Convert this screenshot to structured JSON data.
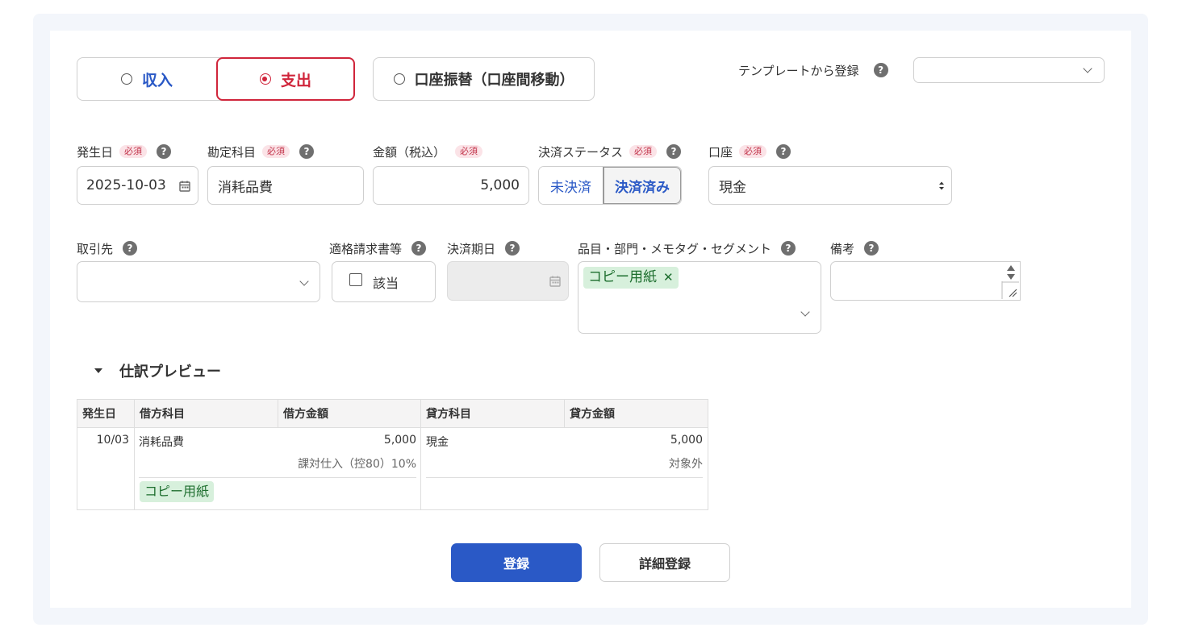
{
  "type_selector": {
    "income": "収入",
    "expense": "支出",
    "transfer": "口座振替（口座間移動）"
  },
  "template": {
    "label": "テンプレートから登録",
    "value": ""
  },
  "help_mark": "?",
  "required_badge": "必須",
  "fields": {
    "date": {
      "label": "発生日",
      "value": "2025-10-03"
    },
    "account_item": {
      "label": "勘定科目",
      "value": "消耗品費"
    },
    "amount": {
      "label": "金額（税込）",
      "value": "5,000"
    },
    "settlement": {
      "label": "決済ステータス",
      "unsettled": "未決済",
      "settled": "決済済み"
    },
    "wallet": {
      "label": "口座",
      "value": "現金"
    },
    "partner": {
      "label": "取引先",
      "value": ""
    },
    "invoice": {
      "label": "適格請求書等",
      "checkbox_label": "該当"
    },
    "due_date": {
      "label": "決済期日"
    },
    "tags": {
      "label": "品目・部門・メモタグ・セグメント",
      "tag": "コピー用紙",
      "remove": "✕"
    },
    "memo": {
      "label": "備考"
    }
  },
  "preview": {
    "title": "仕訳プレビュー",
    "headers": [
      "発生日",
      "借方科目",
      "借方金額",
      "貸方科目",
      "貸方金額"
    ],
    "row": {
      "date": "10/03",
      "debit_item": "消耗品費",
      "debit_amount": "5,000",
      "debit_tax": "課対仕入（控80）10%",
      "credit_item": "現金",
      "credit_amount": "5,000",
      "credit_tax": "対象外",
      "tag": "コピー用紙"
    }
  },
  "buttons": {
    "register": "登録",
    "detail_register": "詳細登録"
  },
  "colors": {
    "accent_blue": "#2a59c6",
    "expense_red": "#d0253b",
    "tag_bg": "#d7f0dc",
    "tag_text": "#1d6e2e"
  }
}
